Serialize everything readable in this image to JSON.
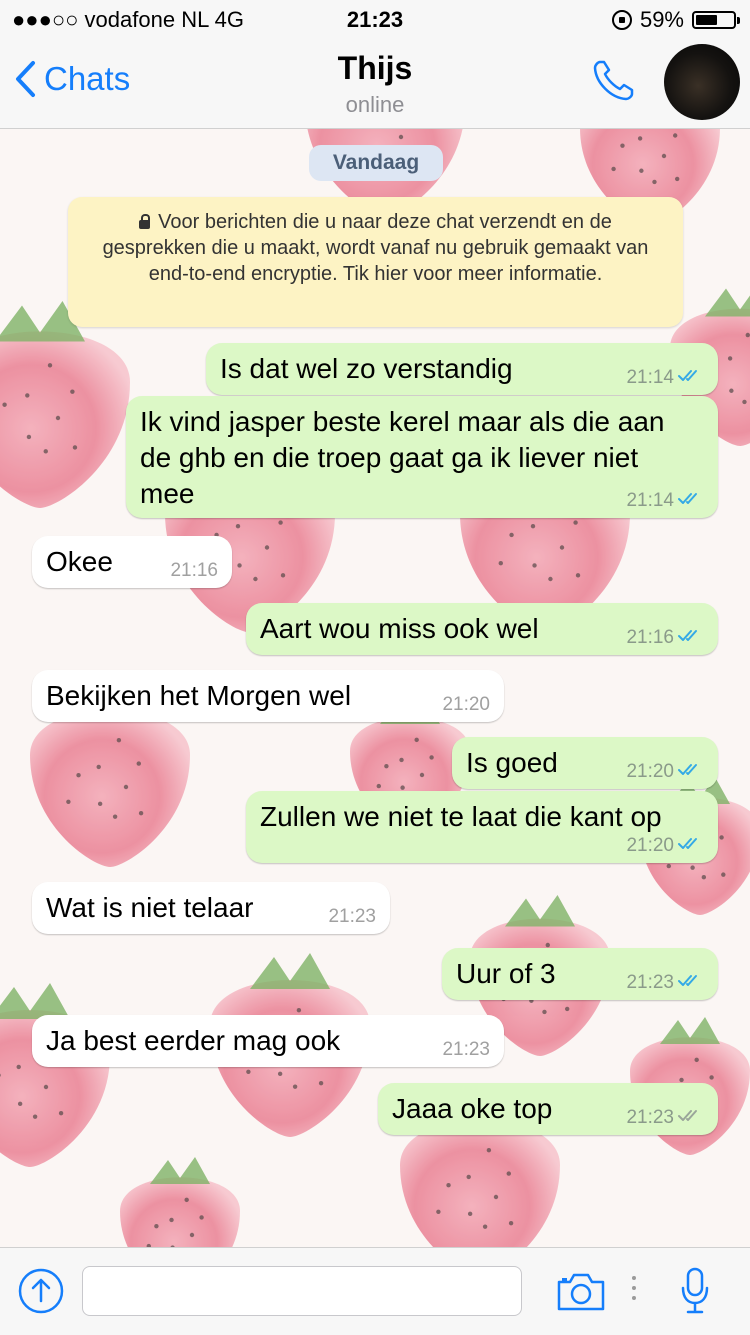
{
  "status_bar": {
    "carrier": "●●●○○ vodafone NL   4G",
    "time": "21:23",
    "battery": "59%"
  },
  "header": {
    "back_label": "Chats",
    "title": "Thijs",
    "subtitle": "online"
  },
  "date_label": "Vandaag",
  "encryption_notice": "Voor berichten die u naar deze chat verzendt en de gesprekken die u maakt, wordt vanaf nu gebruik gemaakt van end-to-end encryptie. Tik hier voor meer informatie.",
  "messages": [
    {
      "direction": "out",
      "text": "Is dat wel zo verstandig",
      "time": "21:14",
      "status": "read"
    },
    {
      "direction": "out",
      "text": "Ik vind jasper beste kerel maar als die aan de ghb en die troep gaat ga ik liever niet mee",
      "time": "21:14",
      "status": "read"
    },
    {
      "direction": "in",
      "text": "Okee",
      "time": "21:16"
    },
    {
      "direction": "out",
      "text": "Aart wou miss ook wel",
      "time": "21:16",
      "status": "read"
    },
    {
      "direction": "in",
      "text": "Bekijken het Morgen wel",
      "time": "21:20"
    },
    {
      "direction": "out",
      "text": "Is goed",
      "time": "21:20",
      "status": "read"
    },
    {
      "direction": "out",
      "text": "Zullen we niet te laat die kant op",
      "time": "21:20",
      "status": "read"
    },
    {
      "direction": "in",
      "text": "Wat is niet telaar",
      "time": "21:23"
    },
    {
      "direction": "out",
      "text": "Uur of 3",
      "time": "21:23",
      "status": "read"
    },
    {
      "direction": "in",
      "text": "Ja best eerder mag ook",
      "time": "21:23"
    },
    {
      "direction": "out",
      "text": "Jaaa oke top",
      "time": "21:23",
      "status": "delivered"
    }
  ],
  "input": {
    "placeholder": ""
  },
  "colors": {
    "accent": "#157efb",
    "outgoing_bubble": "#dcf8c6",
    "incoming_bubble": "#ffffff",
    "read_ticks": "#34a9e6",
    "delivered_ticks": "#9aa59a"
  },
  "icons": [
    "chevron-left-icon",
    "phone-icon",
    "lock-icon",
    "upload-icon",
    "camera-icon",
    "more-icon",
    "microphone-icon"
  ]
}
